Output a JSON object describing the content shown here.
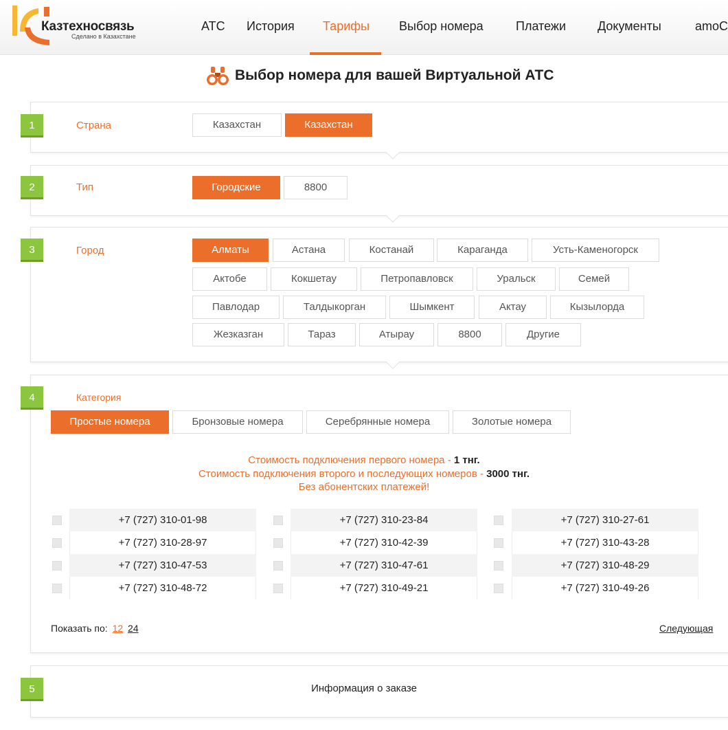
{
  "header": {
    "logo_title": "Казтехносвязь",
    "logo_subtitle": "Сделано в Казахстане",
    "nav": [
      {
        "label": "АТС",
        "active": false
      },
      {
        "label": "История",
        "active": false
      },
      {
        "label": "Тарифы",
        "active": true
      },
      {
        "label": "Выбор номера",
        "active": false
      },
      {
        "label": "Платежи",
        "active": false
      },
      {
        "label": "Документы",
        "active": false
      },
      {
        "label": "amoCRM",
        "active": false
      }
    ]
  },
  "page_title": "Выбор номера для вашей Виртуальной АТС",
  "steps": {
    "country": {
      "number": "1",
      "label": "Страна",
      "options": [
        {
          "label": "Казахстан",
          "selected": false
        },
        {
          "label": "Казахстан",
          "selected": true
        }
      ]
    },
    "type": {
      "number": "2",
      "label": "Тип",
      "options": [
        {
          "label": "Городские",
          "selected": true
        },
        {
          "label": "8800",
          "selected": false
        }
      ]
    },
    "city": {
      "number": "3",
      "label": "Город",
      "options": [
        {
          "label": "Алматы",
          "selected": true
        },
        {
          "label": "Астана",
          "selected": false
        },
        {
          "label": "Костанай",
          "selected": false
        },
        {
          "label": "Караганда",
          "selected": false
        },
        {
          "label": "Усть-Каменогорск",
          "selected": false
        },
        {
          "label": "Актобе",
          "selected": false
        },
        {
          "label": "Кокшетау",
          "selected": false
        },
        {
          "label": "Петропавловск",
          "selected": false
        },
        {
          "label": "Уральск",
          "selected": false
        },
        {
          "label": "Семей",
          "selected": false
        },
        {
          "label": "Павлодар",
          "selected": false
        },
        {
          "label": "Талдыкорган",
          "selected": false
        },
        {
          "label": "Шымкент",
          "selected": false
        },
        {
          "label": "Актау",
          "selected": false
        },
        {
          "label": "Кызылорда",
          "selected": false
        },
        {
          "label": "Жезказган",
          "selected": false
        },
        {
          "label": "Тараз",
          "selected": false
        },
        {
          "label": "Атырау",
          "selected": false
        },
        {
          "label": "8800",
          "selected": false
        },
        {
          "label": "Другие",
          "selected": false
        }
      ]
    },
    "category": {
      "number": "4",
      "label": "Категория",
      "options": [
        {
          "label": "Простые номера",
          "selected": true
        },
        {
          "label": "Бронзовые номера",
          "selected": false
        },
        {
          "label": "Серебрянные номера",
          "selected": false
        },
        {
          "label": "Золотые номера",
          "selected": false
        }
      ],
      "info": {
        "line1_text": "Стоимость подключения первого номера - ",
        "line1_price": "1 тнг.",
        "line2_text": "Стоимость подключения второго и последующих номеров - ",
        "line2_price": "3000 тнг.",
        "line3_text": "Без абонентских платежей!"
      },
      "numbers": [
        [
          "+7 (727) 310-01-98",
          "+7 (727) 310-23-84",
          "+7 (727) 310-27-61"
        ],
        [
          "+7 (727) 310-28-97",
          "+7 (727) 310-42-39",
          "+7 (727) 310-43-28"
        ],
        [
          "+7 (727) 310-47-53",
          "+7 (727) 310-47-61",
          "+7 (727) 310-48-29"
        ],
        [
          "+7 (727) 310-48-72",
          "+7 (727) 310-49-21",
          "+7 (727) 310-49-26"
        ]
      ],
      "pagination": {
        "show_by_label": "Показать по:",
        "sizes": [
          "12",
          "24"
        ],
        "current_size": "12",
        "next_label": "Следующая"
      }
    },
    "order": {
      "number": "5",
      "label": "Информация о заказе"
    }
  },
  "colors": {
    "accent": "#ec6e2b",
    "step_badge": "#8cc63f"
  }
}
